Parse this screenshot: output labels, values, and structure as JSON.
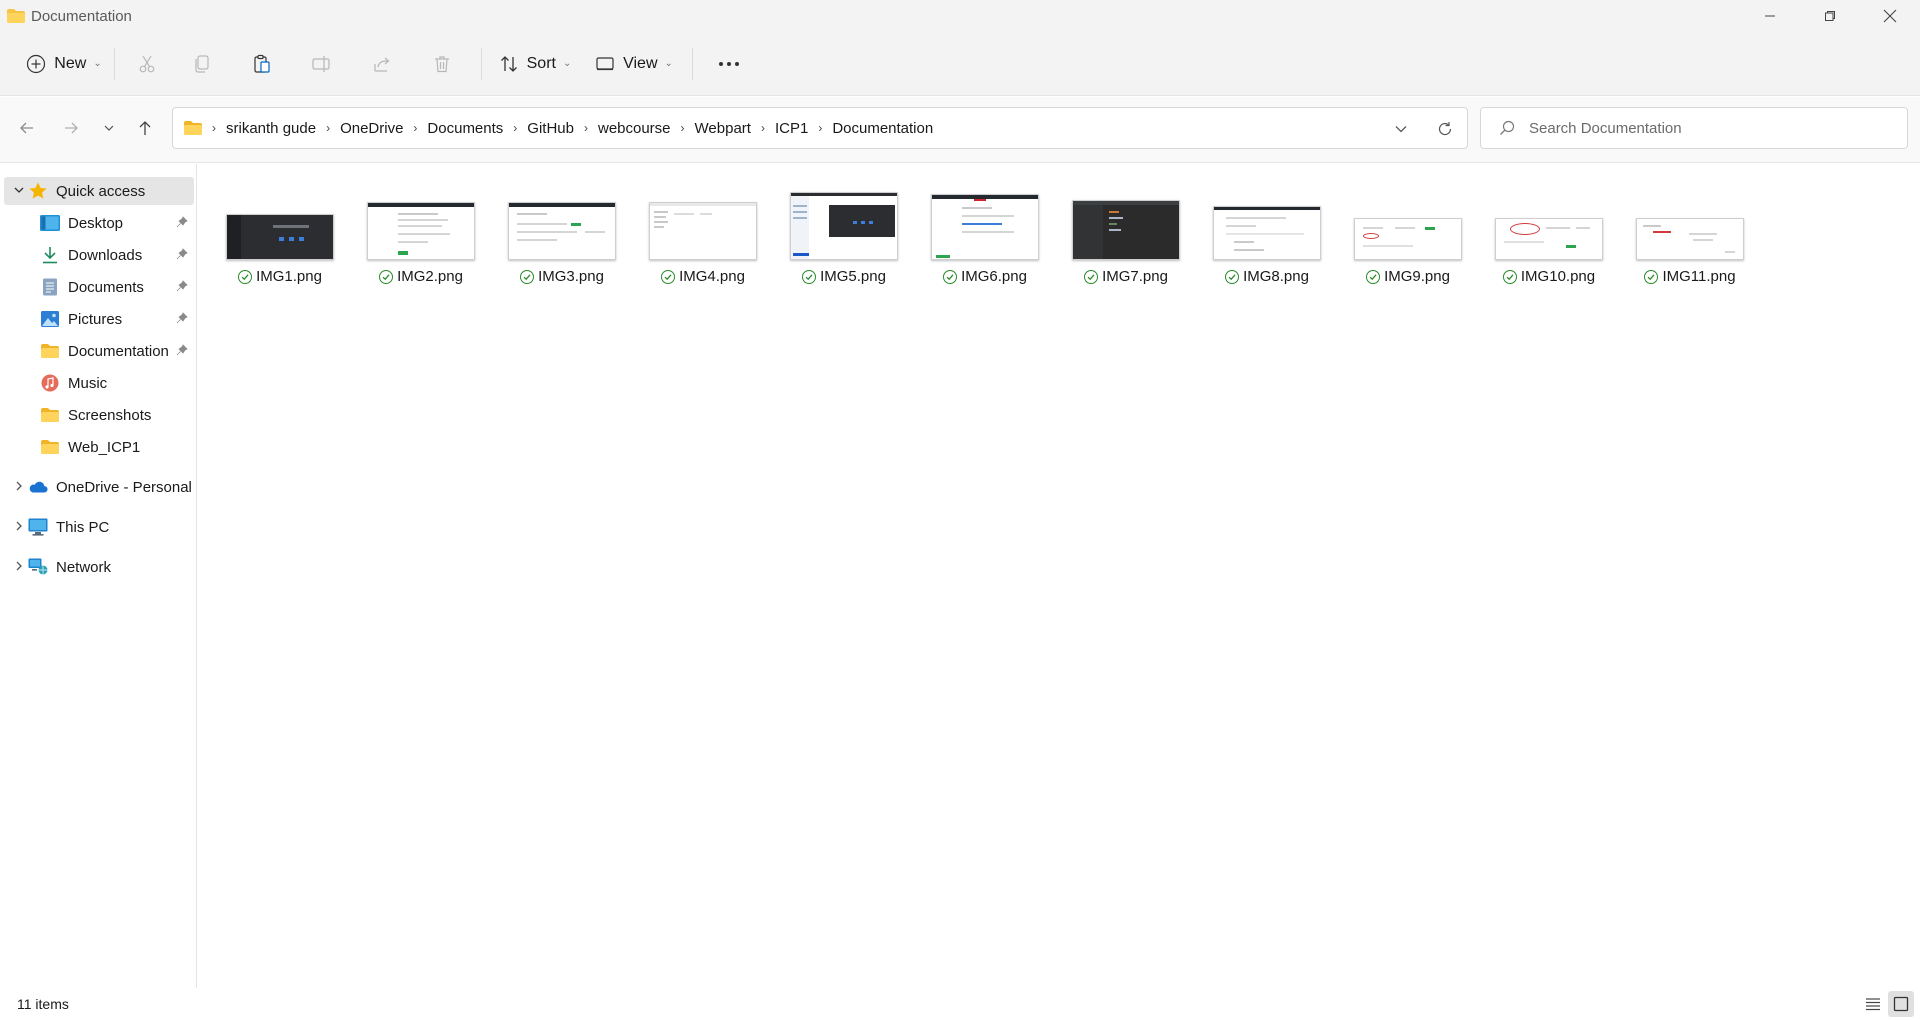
{
  "window": {
    "title": "Documentation",
    "controls": [
      "minimize-icon",
      "restore-icon",
      "close-icon"
    ]
  },
  "commandbar": {
    "new_label": "New",
    "sort_label": "Sort",
    "view_label": "View",
    "icons": [
      "cut-icon",
      "copy-icon",
      "paste-icon",
      "rename-icon",
      "share-icon",
      "delete-icon",
      "more-icon"
    ]
  },
  "address": {
    "crumbs": [
      "srikanth gude",
      "OneDrive",
      "Documents",
      "GitHub",
      "webcourse",
      "Webpart",
      "ICP1",
      "Documentation"
    ]
  },
  "search": {
    "placeholder": "Search Documentation"
  },
  "sidebar": {
    "quick_access": "Quick access",
    "items": [
      {
        "label": "Desktop",
        "icon": "desktop-icon",
        "pinned": true
      },
      {
        "label": "Downloads",
        "icon": "downloads-icon",
        "pinned": true
      },
      {
        "label": "Documents",
        "icon": "documents-icon",
        "pinned": true
      },
      {
        "label": "Pictures",
        "icon": "pictures-icon",
        "pinned": true
      },
      {
        "label": "Documentation",
        "icon": "folder-icon",
        "pinned": true
      },
      {
        "label": "Music",
        "icon": "music-icon",
        "pinned": false
      },
      {
        "label": "Screenshots",
        "icon": "folder-icon",
        "pinned": false
      },
      {
        "label": "Web_ICP1",
        "icon": "folder-icon",
        "pinned": false
      }
    ],
    "onedrive": "OneDrive - Personal",
    "thispc": "This PC",
    "network": "Network"
  },
  "files": [
    {
      "name": "IMG1.png",
      "theme": "dark"
    },
    {
      "name": "IMG2.png",
      "theme": "light"
    },
    {
      "name": "IMG3.png",
      "theme": "light"
    },
    {
      "name": "IMG4.png",
      "theme": "light"
    },
    {
      "name": "IMG5.png",
      "theme": "mixed"
    },
    {
      "name": "IMG6.png",
      "theme": "light"
    },
    {
      "name": "IMG7.png",
      "theme": "dark"
    },
    {
      "name": "IMG8.png",
      "theme": "light"
    },
    {
      "name": "IMG9.png",
      "theme": "light"
    },
    {
      "name": "IMG10.png",
      "theme": "light"
    },
    {
      "name": "IMG11.png",
      "theme": "light"
    }
  ],
  "status": {
    "count": "11 items"
  },
  "colors": {
    "accent": "#0067c0",
    "sync_ok": "#2a8a2a",
    "folder": "#f4c542"
  }
}
